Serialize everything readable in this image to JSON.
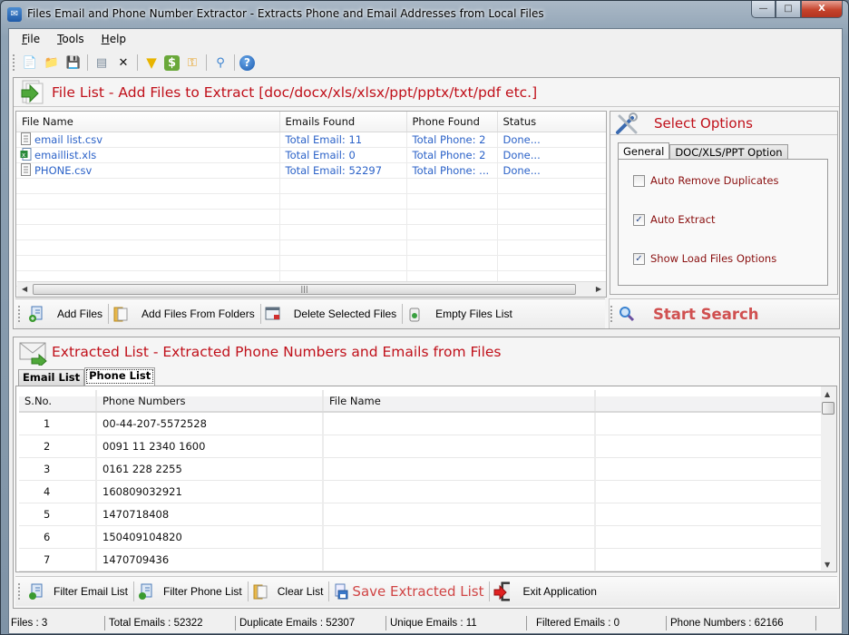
{
  "window": {
    "title": "Files Email and Phone Number Extractor  -  Extracts Phone and Email Addresses from Local Files",
    "controls": {
      "minimize": "—",
      "maximize": "□",
      "close": "X"
    }
  },
  "menu": [
    {
      "key": "F",
      "rest": "ile"
    },
    {
      "key": "T",
      "rest": "ools"
    },
    {
      "key": "H",
      "rest": "elp"
    }
  ],
  "toolbar": {
    "icons": [
      {
        "name": "add-files-icon",
        "glyph": "📄",
        "color": "#2b6fc0"
      },
      {
        "name": "add-folder-icon",
        "glyph": "📁",
        "color": "#d8a63a"
      },
      {
        "name": "save-icon",
        "glyph": "💾",
        "color": "#3a78c8"
      },
      {
        "sep": true
      },
      {
        "name": "delete-file-icon",
        "glyph": "▤",
        "color": "#7a8a9a"
      },
      {
        "name": "close-icon",
        "glyph": "✕",
        "color": "#111"
      },
      {
        "sep": true
      },
      {
        "name": "filter-icon",
        "glyph": "▼",
        "color": "#e8b400"
      },
      {
        "name": "dollar-icon",
        "glyph": "$",
        "color": "#fff"
      },
      {
        "name": "key-icon",
        "glyph": "⚿",
        "color": "#e6a020"
      },
      {
        "sep": true
      },
      {
        "name": "search-icon",
        "glyph": "⚲",
        "color": "#3a82d0"
      },
      {
        "sep": true
      },
      {
        "name": "help-icon",
        "glyph": "?",
        "color": "#fff"
      }
    ]
  },
  "file_panel": {
    "title": "File List - Add Files to Extract  [doc/docx/xls/xlsx/ppt/pptx/txt/pdf etc.]",
    "columns": [
      "File Name",
      "Emails Found",
      "Phone Found",
      "Status"
    ],
    "rows": [
      {
        "icon": "text-file-icon",
        "name": "email list.csv",
        "emails": "Total Email: 11",
        "phones": "Total Phone: 2",
        "status": "Done..."
      },
      {
        "icon": "excel-file-icon",
        "name": "emaillist.xls",
        "emails": "Total Email: 0",
        "phones": "Total Phone: 2",
        "status": "Done..."
      },
      {
        "icon": "text-file-icon",
        "name": "PHONE.csv",
        "emails": "Total Email: 52297",
        "phones": "Total Phone: ...",
        "status": "Done..."
      }
    ],
    "buttons": [
      "Add Files",
      "Add Files From Folders",
      "Delete Selected Files",
      "Empty Files List"
    ]
  },
  "options_panel": {
    "title": "Select Options",
    "tabs": [
      "General",
      "DOC/XLS/PPT Option"
    ],
    "active_tab": "General",
    "options": [
      {
        "label": "Auto Remove Duplicates",
        "checked": false
      },
      {
        "label": "Auto Extract",
        "checked": true
      },
      {
        "label": "Show Load Files Options",
        "checked": true
      }
    ],
    "start_label": "Start Search"
  },
  "extracted_panel": {
    "title": "Extracted List - Extracted Phone Numbers and Emails from Files",
    "tabs": [
      "Email List",
      "Phone List"
    ],
    "active_tab": "Phone List",
    "columns": [
      "S.No.",
      "Phone Numbers",
      "File Name"
    ],
    "rows": [
      {
        "sno": "1",
        "phone": "00-44-207-5572528",
        "file": ""
      },
      {
        "sno": "2",
        "phone": "0091 11 2340 1600",
        "file": ""
      },
      {
        "sno": "3",
        "phone": "0161 228 2255",
        "file": ""
      },
      {
        "sno": "4",
        "phone": "160809032921",
        "file": ""
      },
      {
        "sno": "5",
        "phone": "1470718408",
        "file": ""
      },
      {
        "sno": "6",
        "phone": "150409104820",
        "file": ""
      },
      {
        "sno": "7",
        "phone": "1470709436",
        "file": ""
      }
    ],
    "buttons": {
      "filter_email": "Filter Email List",
      "filter_phone": "Filter Phone List",
      "clear": "Clear List",
      "save": "Save Extracted List",
      "exit": "Exit Application"
    }
  },
  "status": {
    "files": "Files :  3",
    "total_emails": "Total Emails :  52322",
    "duplicate_emails": "Duplicate Emails :  52307",
    "unique_emails": "Unique Emails :  11",
    "filtered_emails": "Filtered Emails :  0",
    "phone_numbers": "Phone Numbers :   62166"
  },
  "colors": {
    "accent_red": "#c0101a",
    "link_blue": "#2b62c8",
    "option_red": "#8a1010",
    "start_red": "#d05050"
  }
}
